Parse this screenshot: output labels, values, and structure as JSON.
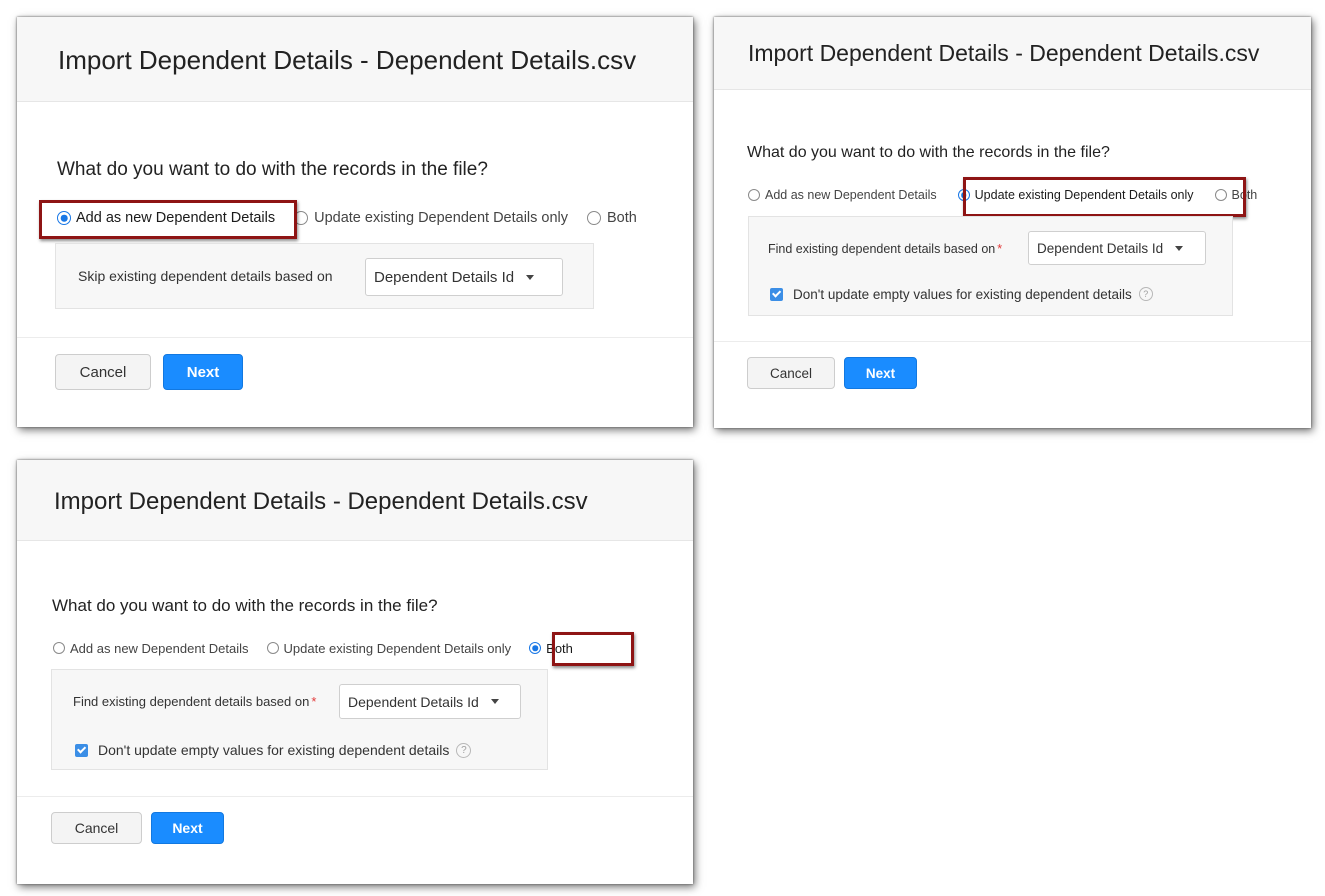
{
  "dialogs": [
    {
      "title": "Import Dependent Details - Dependent Details.csv",
      "question": "What do you want to do with the records in the file?",
      "options": [
        {
          "label": "Add as new Dependent Details",
          "selected": true
        },
        {
          "label": "Update existing Dependent Details only",
          "selected": false
        },
        {
          "label": "Both",
          "selected": false
        }
      ],
      "field_label": "Skip existing dependent details based on",
      "field_value": "Dependent Details Id",
      "cancel_label": "Cancel",
      "next_label": "Next"
    },
    {
      "title": "Import Dependent Details - Dependent Details.csv",
      "question": "What do you want to do with the records in the file?",
      "options": [
        {
          "label": "Add as new Dependent Details",
          "selected": false
        },
        {
          "label": "Update existing Dependent Details only",
          "selected": true
        },
        {
          "label": "Both",
          "selected": false
        }
      ],
      "field_label": "Find existing dependent details based on",
      "required_mark": "*",
      "field_value": "Dependent Details Id",
      "checkbox_label": "Don't update empty values for existing dependent details",
      "checkbox_checked": true,
      "help_symbol": "?",
      "cancel_label": "Cancel",
      "next_label": "Next"
    },
    {
      "title": "Import Dependent Details - Dependent Details.csv",
      "question": "What do you want to do with the records in the file?",
      "options": [
        {
          "label": "Add as new Dependent Details",
          "selected": false
        },
        {
          "label": "Update existing Dependent Details only",
          "selected": false
        },
        {
          "label": "Both",
          "selected": true
        }
      ],
      "field_label": "Find existing dependent details based on",
      "required_mark": "*",
      "field_value": "Dependent Details Id",
      "checkbox_label": "Don't update empty values for existing dependent details",
      "checkbox_checked": true,
      "help_symbol": "?",
      "cancel_label": "Cancel",
      "next_label": "Next"
    }
  ],
  "colors": {
    "accent": "#1877e6",
    "next_button": "#1a8cff",
    "highlight_frame": "#8e1414"
  }
}
